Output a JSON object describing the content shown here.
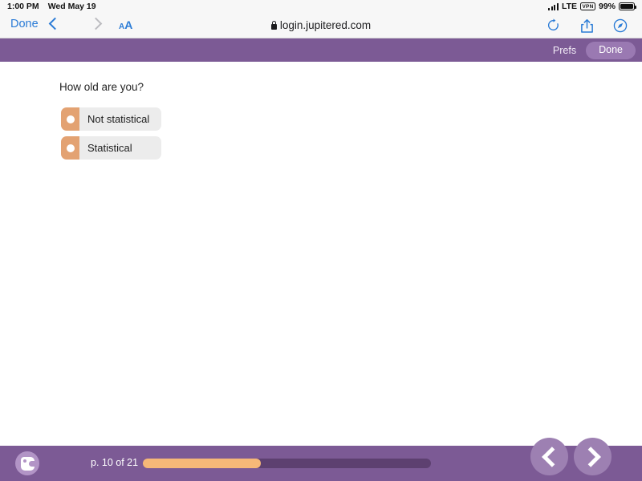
{
  "status_bar": {
    "time": "1:00 PM",
    "date": "Wed May 19",
    "carrier": "LTE",
    "vpn_label": "VPN",
    "battery_percent": "99%",
    "signal_icon": "signal-bars-icon",
    "battery_icon": "battery-icon"
  },
  "browser": {
    "done_label": "Done",
    "back_icon": "chevron-left-icon",
    "forward_icon": "chevron-right-icon",
    "text_size_small": "A",
    "text_size_large": "A",
    "url": "login.jupitered.com",
    "lock_icon": "lock-icon",
    "reload_icon": "reload-icon",
    "share_icon": "share-icon",
    "tabs_icon": "compass-icon"
  },
  "app_header": {
    "prefs_label": "Prefs",
    "done_label": "Done",
    "background_color": "#7c5a95",
    "done_pill_color": "#9a79b2"
  },
  "quiz": {
    "question": "How old are you?",
    "options": [
      {
        "label": "Not statistical",
        "selected": false
      },
      {
        "label": "Statistical",
        "selected": false
      }
    ],
    "radio_color": "#e3a272",
    "option_bg_color": "#ececec"
  },
  "footer": {
    "logo_icon": "jupiter-ed-logo-icon",
    "page_counter": "p. 10 of 21",
    "progress_percent": 41,
    "progress_fill_color": "#f6b878",
    "progress_track_color": "#5d4070",
    "prev_icon": "chevron-left-icon",
    "next_icon": "chevron-right-icon"
  }
}
